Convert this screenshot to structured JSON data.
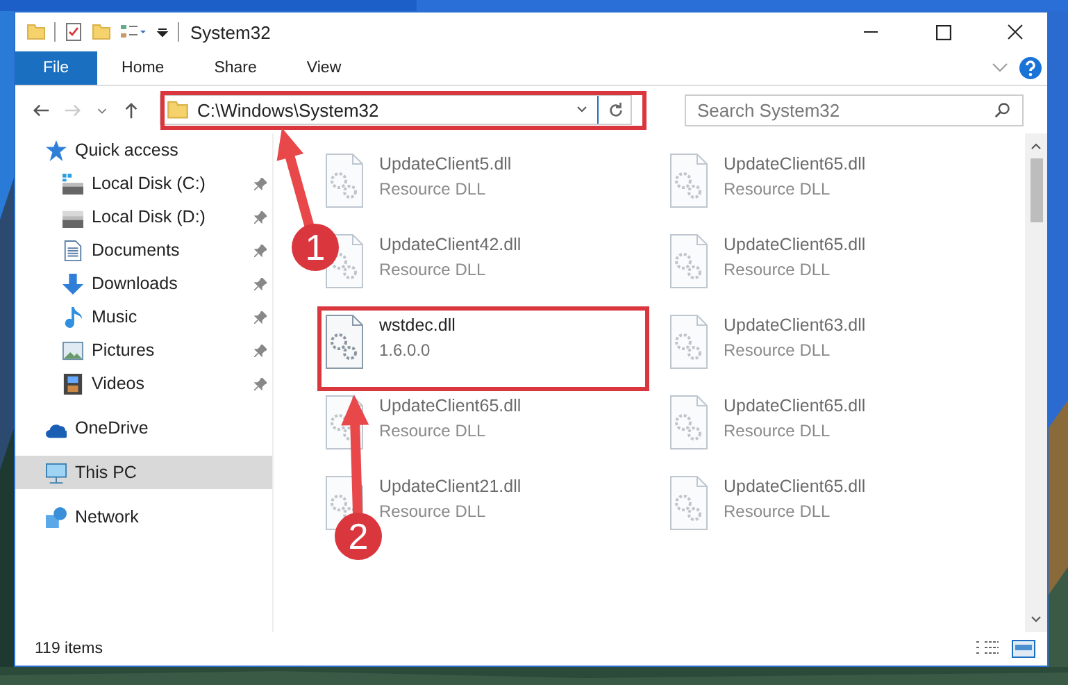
{
  "window": {
    "title": "System32"
  },
  "ribbon_tabs": [
    {
      "label": "File",
      "selected": true
    },
    {
      "label": "Home",
      "selected": false
    },
    {
      "label": "Share",
      "selected": false
    },
    {
      "label": "View",
      "selected": false
    }
  ],
  "address_bar": {
    "path": "C:\\Windows\\System32"
  },
  "search": {
    "placeholder": "Search System32"
  },
  "sidebar": {
    "items": [
      {
        "label": "Quick access",
        "kind": "star",
        "selected": false,
        "children": [
          {
            "label": "Local Disk (C:)",
            "kind": "disk-c",
            "pinned": true,
            "selected": false
          },
          {
            "label": "Local Disk (D:)",
            "kind": "disk",
            "pinned": true,
            "selected": false
          },
          {
            "label": "Documents",
            "kind": "document",
            "pinned": true,
            "selected": false
          },
          {
            "label": "Downloads",
            "kind": "download",
            "pinned": true,
            "selected": false
          },
          {
            "label": "Music",
            "kind": "music",
            "pinned": true,
            "selected": false
          },
          {
            "label": "Pictures",
            "kind": "pictures",
            "pinned": true,
            "selected": false
          },
          {
            "label": "Videos",
            "kind": "videos",
            "pinned": true,
            "selected": false
          }
        ]
      },
      {
        "label": "OneDrive",
        "kind": "cloud",
        "selected": false
      },
      {
        "label": "This PC",
        "kind": "pc",
        "selected": true
      },
      {
        "label": "Network",
        "kind": "network",
        "selected": false
      }
    ]
  },
  "files": [
    {
      "name": "UpdateClient5.dll",
      "detail": "Resource DLL",
      "dimmed": true
    },
    {
      "name": "UpdateClient65.dll",
      "detail": "Resource DLL",
      "dimmed": true
    },
    {
      "name": "UpdateClient42.dll",
      "detail": "Resource DLL",
      "dimmed": true
    },
    {
      "name": "UpdateClient65.dll",
      "detail": "Resource DLL",
      "dimmed": true
    },
    {
      "name": "wstdec.dll",
      "detail": "1.6.0.0",
      "dimmed": false
    },
    {
      "name": "UpdateClient63.dll",
      "detail": "Resource DLL",
      "dimmed": true
    },
    {
      "name": "UpdateClient65.dll",
      "detail": "Resource DLL",
      "dimmed": true
    },
    {
      "name": "UpdateClient65.dll",
      "detail": "Resource DLL",
      "dimmed": true
    },
    {
      "name": "UpdateClient21.dll",
      "detail": "Resource DLL",
      "dimmed": true
    },
    {
      "name": "UpdateClient65.dll",
      "detail": "Resource DLL",
      "dimmed": true
    }
  ],
  "status_bar": {
    "item_count": "119 items"
  },
  "annotations": [
    {
      "number": "1"
    },
    {
      "number": "2"
    }
  ]
}
